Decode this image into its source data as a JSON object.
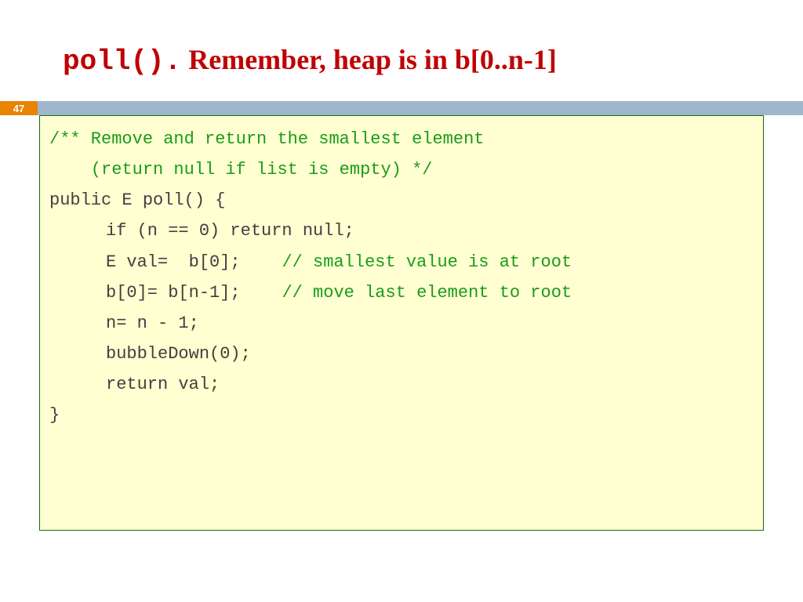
{
  "slide_number": "47",
  "title": {
    "code_part": "poll().",
    "text_part": "  Remember, heap is in b[0..n-1]"
  },
  "code": {
    "l1": "/** Remove and return the smallest element",
    "l2": "    (return null if list is empty) */",
    "l3": "public E poll() {",
    "l4_code": "if (n == 0) return null;",
    "l5_code": "E val=  b[0];",
    "l5_comment": "    // smallest value is at root",
    "l6_code": "b[0]= b[n-1];",
    "l6_comment": "    // move last element to root",
    "l7_code": "n= n - 1;",
    "l8_code": "bubbleDown(0);",
    "l9_code": "return val;",
    "l10": "}"
  }
}
